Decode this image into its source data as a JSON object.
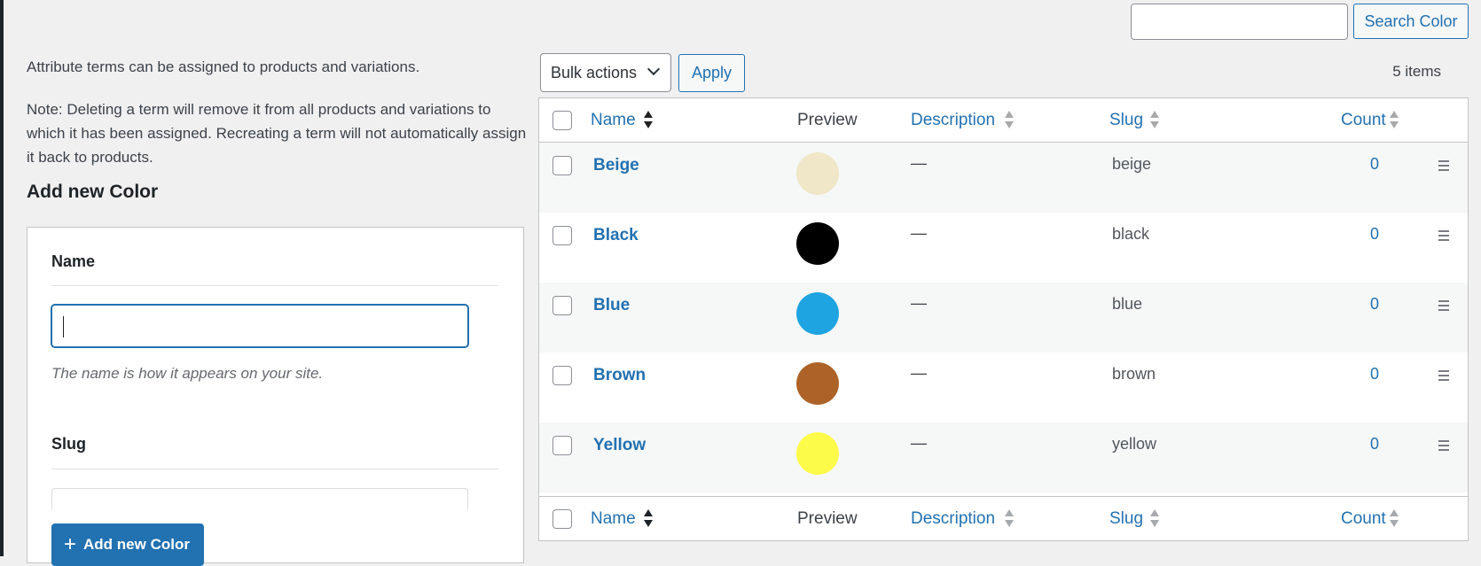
{
  "search": {
    "placeholder": "",
    "button_label": "Search Color"
  },
  "left": {
    "intro": "Attribute terms can be assigned to products and variations.",
    "note": "Note: Deleting a term will remove it from all products and variations to which it has been assigned. Recreating a term will not automatically assign it back to products.",
    "heading": "Add new Color",
    "name_label": "Name",
    "name_value": "",
    "name_help": "The name is how it appears on your site.",
    "slug_label": "Slug",
    "add_button": "Add new Color"
  },
  "toolbar": {
    "bulk_label": "Bulk actions",
    "apply_label": "Apply",
    "items_count": "5 items"
  },
  "table": {
    "columns": {
      "name": "Name",
      "preview": "Preview",
      "description": "Description",
      "slug": "Slug",
      "count": "Count"
    },
    "rows": [
      {
        "name": "Beige",
        "color": "#efe7c8",
        "description": "—",
        "slug": "beige",
        "count": "0"
      },
      {
        "name": "Black",
        "color": "#000000",
        "description": "—",
        "slug": "black",
        "count": "0"
      },
      {
        "name": "Blue",
        "color": "#1ea4e1",
        "description": "—",
        "slug": "blue",
        "count": "0"
      },
      {
        "name": "Brown",
        "color": "#ad6328",
        "description": "—",
        "slug": "brown",
        "count": "0"
      },
      {
        "name": "Yellow",
        "color": "#fdfb4a",
        "description": "—",
        "slug": "yellow",
        "count": "0"
      }
    ]
  }
}
